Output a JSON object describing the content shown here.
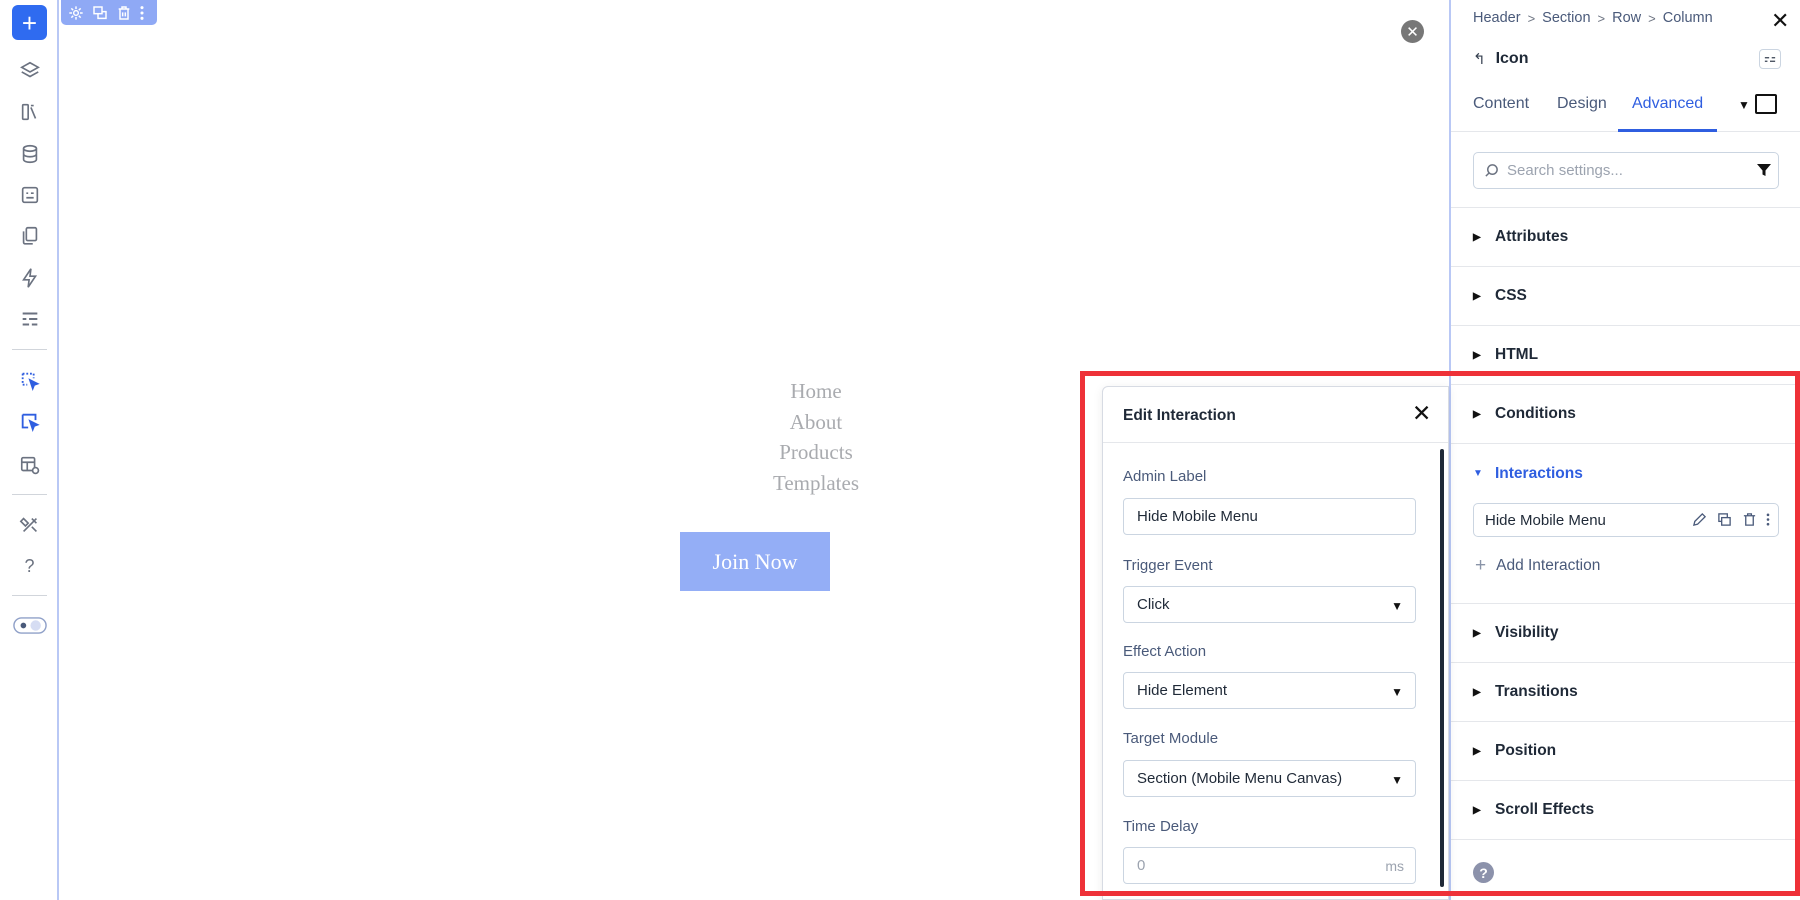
{
  "left_toolbar": {
    "items": [
      "add-icon",
      "layers-icon",
      "library-icon",
      "database-icon",
      "forms-icon",
      "pages-icon",
      "bolt-icon",
      "list-icon",
      "interaction-cursor-icon",
      "interaction-cursor-active-icon",
      "preview-icon",
      "tools-icon",
      "help-icon",
      "theme-toggle-icon"
    ],
    "add_label": "+",
    "help_label": "?"
  },
  "canvas": {
    "menu_items": [
      "Home",
      "About",
      "Products",
      "Templates"
    ],
    "join_button": "Join Now",
    "close_label": "✕"
  },
  "panel": {
    "breadcrumbs": [
      "Header",
      "Section",
      "Row",
      "Column"
    ],
    "breadcrumb_sep": ">",
    "close_label": "✕",
    "back_arrow": "↰",
    "module_name": "Icon",
    "tabs": [
      "Content",
      "Design",
      "Advanced"
    ],
    "active_tab": "Advanced",
    "search_placeholder": "Search settings...",
    "groups": [
      "Attributes",
      "CSS",
      "HTML",
      "Conditions",
      "Interactions",
      "Visibility",
      "Transitions",
      "Position",
      "Scroll Effects"
    ],
    "open_group": "Interactions",
    "interaction_item": "Hide Mobile Menu",
    "add_interaction": "Add Interaction",
    "help_label": "?"
  },
  "modal": {
    "title": "Edit Interaction",
    "close_label": "✕",
    "fields": {
      "admin_label": {
        "label": "Admin Label",
        "value": "Hide Mobile Menu"
      },
      "trigger_event": {
        "label": "Trigger Event",
        "value": "Click"
      },
      "effect_action": {
        "label": "Effect Action",
        "value": "Hide Element"
      },
      "target_module": {
        "label": "Target Module",
        "value": "Section (Mobile Menu Canvas)"
      },
      "time_delay": {
        "label": "Time Delay",
        "placeholder": "0",
        "unit": "ms"
      }
    }
  },
  "colors": {
    "accent": "#2f5ee0",
    "highlight": "#ee3138",
    "button": "#94aef6"
  }
}
